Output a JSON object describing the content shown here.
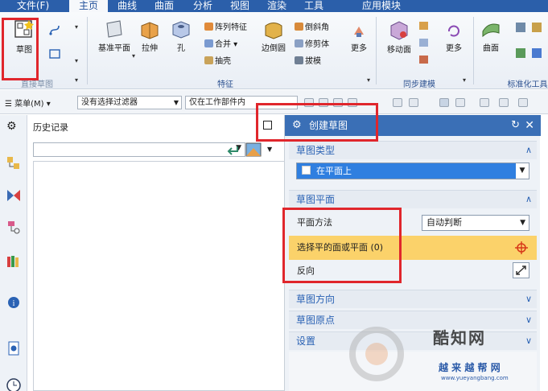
{
  "menu_tabs": [
    "文件(F)",
    "主页",
    "曲线",
    "曲面",
    "分析",
    "视图",
    "渲染",
    "工具",
    "应用模块"
  ],
  "ribbon": {
    "sketch": "草图",
    "direct_sketch_group": "直接草图",
    "datum_plane": "基准平面",
    "extrude": "拉伸",
    "hole": "孔",
    "pattern_feature": "阵列特征",
    "unite": "合并",
    "shell": "抽壳",
    "edge_blend": "边倒圆",
    "chamfer": "倒斜角",
    "trim_body": "修剪体",
    "draft": "拔模",
    "more": "更多",
    "feature_group": "特征",
    "move_face": "移动面",
    "sync_more": "更多",
    "sync_group": "同步建模",
    "surface": "曲面",
    "standard_group": "标准化工具"
  },
  "selection_bar": {
    "menu": "菜单(M)",
    "filter": "没有选择过滤器",
    "scope": "仅在工作部件内"
  },
  "history": {
    "title": "历史记录"
  },
  "dialog": {
    "title": "创建草图",
    "sec_type": "草图类型",
    "type_value": "在平面上",
    "sec_plane": "草图平面",
    "plane_method_label": "平面方法",
    "plane_method_value": "自动判断",
    "select_face": "选择平的面或平面 (0)",
    "reverse": "反向",
    "sec_orient": "草图方向",
    "sec_origin": "草图原点",
    "sec_settings": "设置"
  },
  "watermark": {
    "brand": "酷知网",
    "brand2": "越 来 越 帮 网",
    "url": "www.yueyangbang.com"
  },
  "colors": {
    "title_bar": "#3a6fb6",
    "highlight": "#fbd26a",
    "annotation": "#e0262c",
    "selection": "#2f7fe0"
  }
}
